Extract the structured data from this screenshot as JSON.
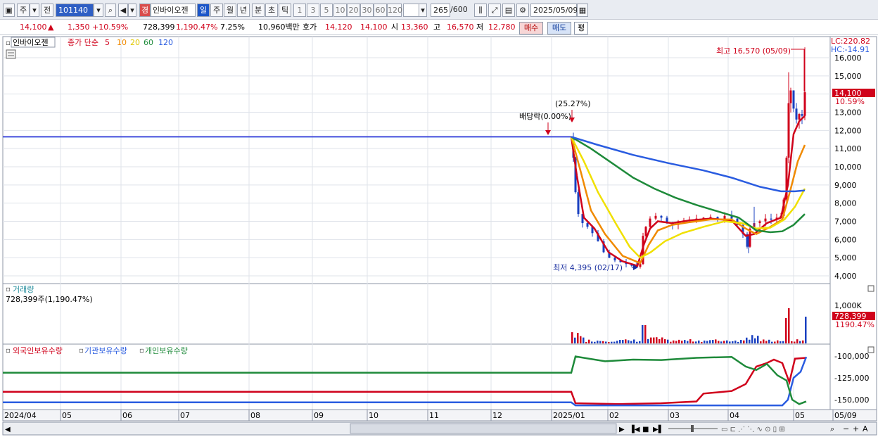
{
  "toolbar": {
    "market_label": "주",
    "prev_label": "전",
    "code": "101140",
    "stock_name": "인바이오젠",
    "warn_label": "경",
    "periods": [
      "일",
      "주",
      "월",
      "년",
      "분",
      "초",
      "틱"
    ],
    "intervals": [
      "1",
      "3",
      "5",
      "10",
      "20",
      "30",
      "60",
      "120"
    ],
    "count": "265",
    "count_total": "/600",
    "date": "2025/05/09"
  },
  "info": {
    "price": "14,100",
    "change": "1,350",
    "change_pct": "+10.59%",
    "volume": "728,399",
    "volume_pct": "1,190.47%",
    "turnover": "7.25%",
    "amount": "10,960백만",
    "ask_label": "호가",
    "ask1": "14,120",
    "ask2": "14,100",
    "open_label": "시",
    "open": "13,360",
    "high_label": "고",
    "high": "16,570",
    "low_label": "저",
    "low": "12,780",
    "buy": "매수",
    "sell": "매도",
    "flat": "평"
  },
  "price_panel": {
    "title": "인바이오젠",
    "ma_label": "종가 단순",
    "ma_periods": [
      "5",
      "10",
      "20",
      "60",
      "120"
    ],
    "ma_colors": [
      "#d0021b",
      "#f08a00",
      "#f0e000",
      "#1e8a3a",
      "#2a5ce0"
    ],
    "lc_label": "LC:220.82",
    "hc_label": "HC:-14.91",
    "high_annotation": "최고 16,570 (05/09)",
    "low_annotation": "최저 4,395 (02/17)",
    "dividend_annotation": "배당락(0.00%)",
    "pct_annotation": "(25.27%)",
    "price_tag": "14,100",
    "pct_tag": "10.59%",
    "y_ticks": [
      "16,000",
      "15,000",
      "14,000",
      "13,000",
      "12,000",
      "11,000",
      "10,000",
      "9,000",
      "8,000",
      "7,000",
      "6,000",
      "5,000",
      "4,000"
    ]
  },
  "volume_panel": {
    "title": "거래량",
    "value": "728,399주(1,190.47%)",
    "tick": "1,000K",
    "tag_value": "728,399",
    "tag_pct": "1190.47%"
  },
  "holder_panel": {
    "series": [
      "외국인보유수량",
      "기관보유수량",
      "개인보유수량"
    ],
    "colors": [
      "#d0021b",
      "#2a5ce0",
      "#1e8a3a"
    ],
    "y_ticks": [
      "-100,000",
      "-125,000",
      "-150,000"
    ]
  },
  "x_axis": [
    "2024/04",
    "05",
    "06",
    "07",
    "08",
    "09",
    "10",
    "11",
    "12",
    "2025/01",
    "02",
    "03",
    "04",
    "05",
    "05/09"
  ]
}
